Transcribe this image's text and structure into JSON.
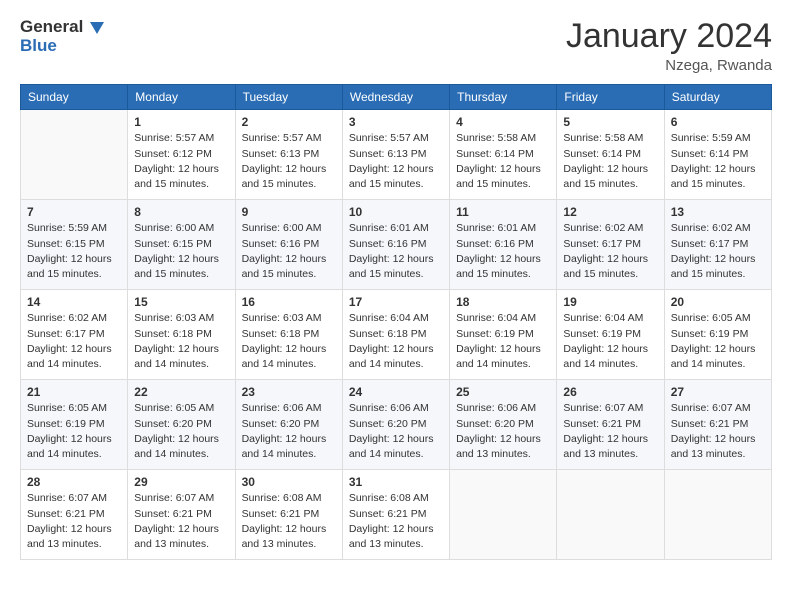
{
  "header": {
    "logo_line1": "General",
    "logo_line2": "Blue",
    "month_title": "January 2024",
    "location": "Nzega, Rwanda"
  },
  "weekdays": [
    "Sunday",
    "Monday",
    "Tuesday",
    "Wednesday",
    "Thursday",
    "Friday",
    "Saturday"
  ],
  "weeks": [
    [
      {
        "day": "",
        "info": ""
      },
      {
        "day": "1",
        "info": "Sunrise: 5:57 AM\nSunset: 6:12 PM\nDaylight: 12 hours\nand 15 minutes."
      },
      {
        "day": "2",
        "info": "Sunrise: 5:57 AM\nSunset: 6:13 PM\nDaylight: 12 hours\nand 15 minutes."
      },
      {
        "day": "3",
        "info": "Sunrise: 5:57 AM\nSunset: 6:13 PM\nDaylight: 12 hours\nand 15 minutes."
      },
      {
        "day": "4",
        "info": "Sunrise: 5:58 AM\nSunset: 6:14 PM\nDaylight: 12 hours\nand 15 minutes."
      },
      {
        "day": "5",
        "info": "Sunrise: 5:58 AM\nSunset: 6:14 PM\nDaylight: 12 hours\nand 15 minutes."
      },
      {
        "day": "6",
        "info": "Sunrise: 5:59 AM\nSunset: 6:14 PM\nDaylight: 12 hours\nand 15 minutes."
      }
    ],
    [
      {
        "day": "7",
        "info": "Sunrise: 5:59 AM\nSunset: 6:15 PM\nDaylight: 12 hours\nand 15 minutes."
      },
      {
        "day": "8",
        "info": "Sunrise: 6:00 AM\nSunset: 6:15 PM\nDaylight: 12 hours\nand 15 minutes."
      },
      {
        "day": "9",
        "info": "Sunrise: 6:00 AM\nSunset: 6:16 PM\nDaylight: 12 hours\nand 15 minutes."
      },
      {
        "day": "10",
        "info": "Sunrise: 6:01 AM\nSunset: 6:16 PM\nDaylight: 12 hours\nand 15 minutes."
      },
      {
        "day": "11",
        "info": "Sunrise: 6:01 AM\nSunset: 6:16 PM\nDaylight: 12 hours\nand 15 minutes."
      },
      {
        "day": "12",
        "info": "Sunrise: 6:02 AM\nSunset: 6:17 PM\nDaylight: 12 hours\nand 15 minutes."
      },
      {
        "day": "13",
        "info": "Sunrise: 6:02 AM\nSunset: 6:17 PM\nDaylight: 12 hours\nand 15 minutes."
      }
    ],
    [
      {
        "day": "14",
        "info": "Sunrise: 6:02 AM\nSunset: 6:17 PM\nDaylight: 12 hours\nand 14 minutes."
      },
      {
        "day": "15",
        "info": "Sunrise: 6:03 AM\nSunset: 6:18 PM\nDaylight: 12 hours\nand 14 minutes."
      },
      {
        "day": "16",
        "info": "Sunrise: 6:03 AM\nSunset: 6:18 PM\nDaylight: 12 hours\nand 14 minutes."
      },
      {
        "day": "17",
        "info": "Sunrise: 6:04 AM\nSunset: 6:18 PM\nDaylight: 12 hours\nand 14 minutes."
      },
      {
        "day": "18",
        "info": "Sunrise: 6:04 AM\nSunset: 6:19 PM\nDaylight: 12 hours\nand 14 minutes."
      },
      {
        "day": "19",
        "info": "Sunrise: 6:04 AM\nSunset: 6:19 PM\nDaylight: 12 hours\nand 14 minutes."
      },
      {
        "day": "20",
        "info": "Sunrise: 6:05 AM\nSunset: 6:19 PM\nDaylight: 12 hours\nand 14 minutes."
      }
    ],
    [
      {
        "day": "21",
        "info": "Sunrise: 6:05 AM\nSunset: 6:19 PM\nDaylight: 12 hours\nand 14 minutes."
      },
      {
        "day": "22",
        "info": "Sunrise: 6:05 AM\nSunset: 6:20 PM\nDaylight: 12 hours\nand 14 minutes."
      },
      {
        "day": "23",
        "info": "Sunrise: 6:06 AM\nSunset: 6:20 PM\nDaylight: 12 hours\nand 14 minutes."
      },
      {
        "day": "24",
        "info": "Sunrise: 6:06 AM\nSunset: 6:20 PM\nDaylight: 12 hours\nand 14 minutes."
      },
      {
        "day": "25",
        "info": "Sunrise: 6:06 AM\nSunset: 6:20 PM\nDaylight: 12 hours\nand 13 minutes."
      },
      {
        "day": "26",
        "info": "Sunrise: 6:07 AM\nSunset: 6:21 PM\nDaylight: 12 hours\nand 13 minutes."
      },
      {
        "day": "27",
        "info": "Sunrise: 6:07 AM\nSunset: 6:21 PM\nDaylight: 12 hours\nand 13 minutes."
      }
    ],
    [
      {
        "day": "28",
        "info": "Sunrise: 6:07 AM\nSunset: 6:21 PM\nDaylight: 12 hours\nand 13 minutes."
      },
      {
        "day": "29",
        "info": "Sunrise: 6:07 AM\nSunset: 6:21 PM\nDaylight: 12 hours\nand 13 minutes."
      },
      {
        "day": "30",
        "info": "Sunrise: 6:08 AM\nSunset: 6:21 PM\nDaylight: 12 hours\nand 13 minutes."
      },
      {
        "day": "31",
        "info": "Sunrise: 6:08 AM\nSunset: 6:21 PM\nDaylight: 12 hours\nand 13 minutes."
      },
      {
        "day": "",
        "info": ""
      },
      {
        "day": "",
        "info": ""
      },
      {
        "day": "",
        "info": ""
      }
    ]
  ]
}
